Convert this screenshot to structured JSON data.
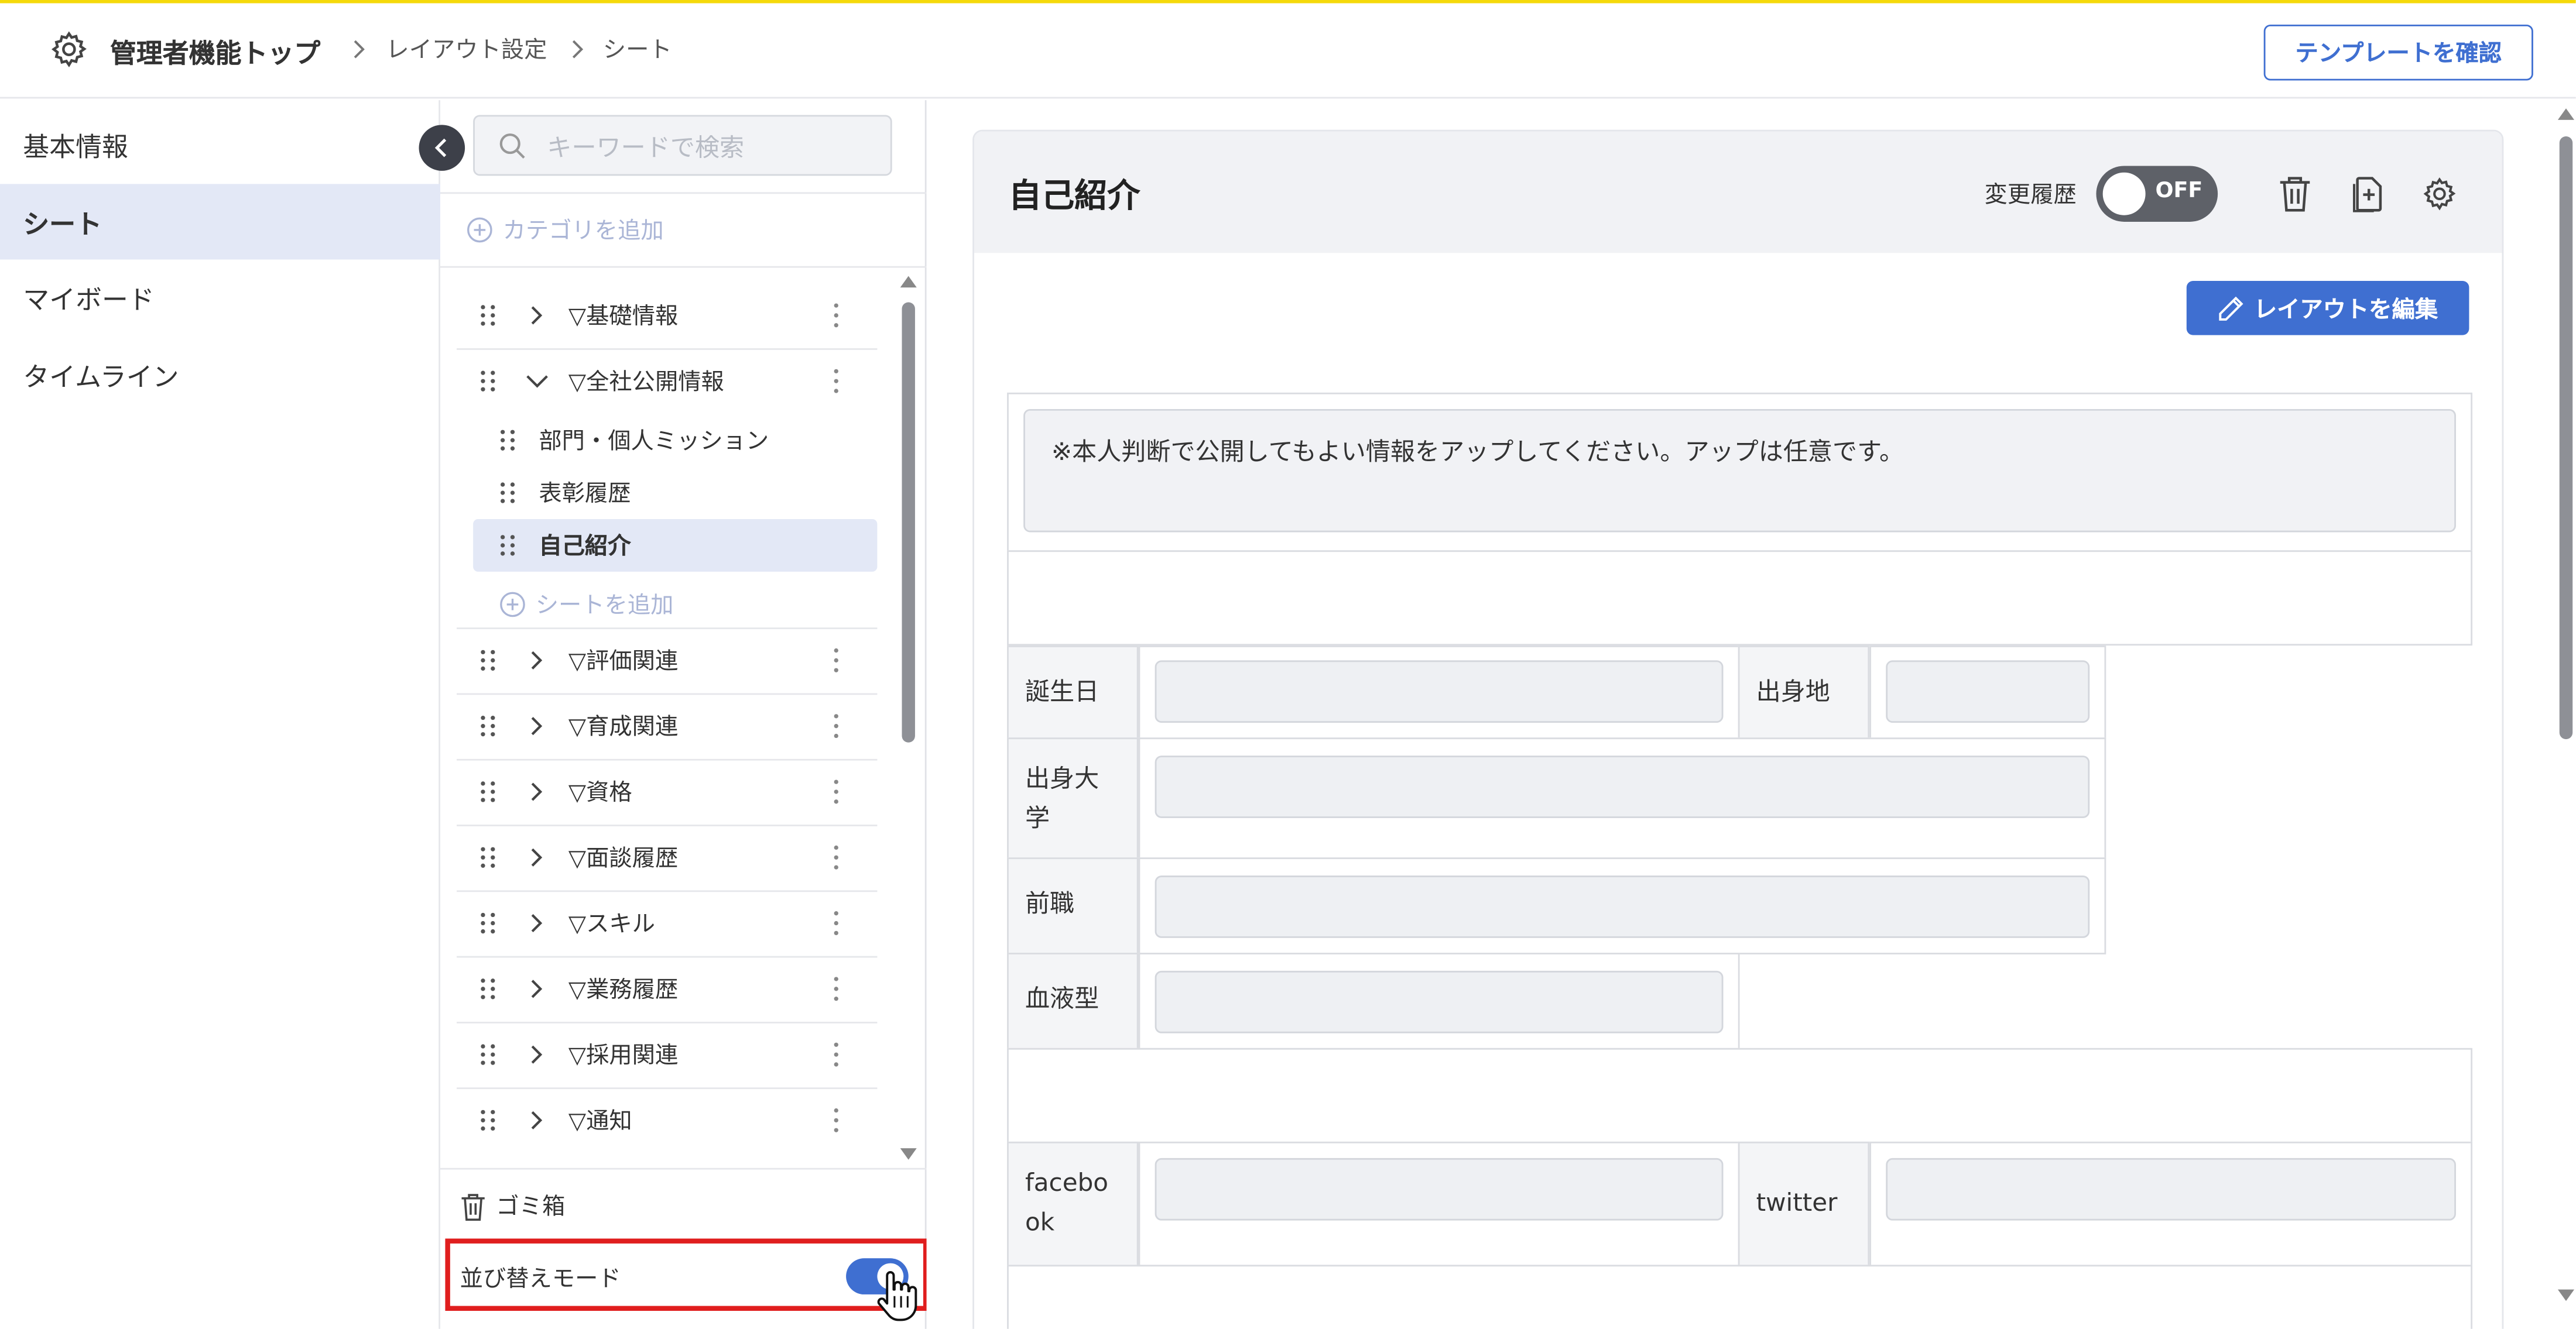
{
  "colors": {
    "accent": "#3f6fd1",
    "highlight_border": "#e01e1e",
    "top_line": "#f5d90a",
    "active_bg": "#e3e8f6"
  },
  "header": {
    "icon": "gear-icon",
    "breadcrumb": [
      "管理者機能トップ",
      "レイアウト設定",
      "シート"
    ],
    "template_button": "テンプレートを確認"
  },
  "leftnav": {
    "items": [
      "基本情報",
      "シート",
      "マイボード",
      "タイムライン"
    ],
    "active_index": 1
  },
  "panel": {
    "search_placeholder": "キーワードで検索",
    "add_category": "カテゴリを追加",
    "categories": [
      {
        "label": "▽基礎情報",
        "expanded": false
      },
      {
        "label": "▽全社公開情報",
        "expanded": true
      },
      {
        "label": "▽評価関連",
        "expanded": false
      },
      {
        "label": "▽育成関連",
        "expanded": false
      },
      {
        "label": "▽資格",
        "expanded": false
      },
      {
        "label": "▽面談履歴",
        "expanded": false
      },
      {
        "label": "▽スキル",
        "expanded": false
      },
      {
        "label": "▽業務履歴",
        "expanded": false
      },
      {
        "label": "▽採用関連",
        "expanded": false
      },
      {
        "label": "▽通知",
        "expanded": false
      }
    ],
    "sheets": [
      "部門・個人ミッション",
      "表彰履歴",
      "自己紹介"
    ],
    "active_sheet": "自己紹介",
    "add_sheet": "シートを追加",
    "trash": "ゴミ箱",
    "sort_mode": {
      "label": "並び替えモード",
      "on": true
    }
  },
  "main": {
    "title": "自己紹介",
    "history_label": "変更履歴",
    "history_toggle": "OFF",
    "edit_layout_button": "レイアウトを編集",
    "note": "※本人判断で公開してもよい情報をアップしてください。アップは任意です。",
    "fields": {
      "birthday": "誕生日",
      "birthplace": "出身地",
      "university": "出身大学",
      "previous_job": "前職",
      "blood_type": "血液型",
      "facebook": "facebook",
      "twitter": "twitter"
    }
  }
}
